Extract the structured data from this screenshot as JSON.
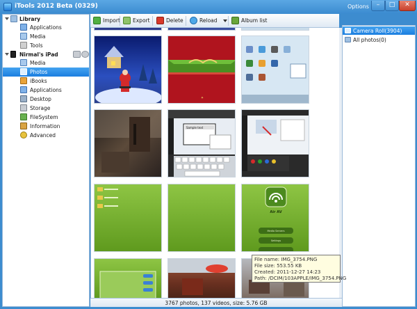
{
  "window": {
    "title": "iTools 2012 Beta (0329)",
    "options_label": "Options",
    "minimize": "–",
    "maximize": "□",
    "close": "✕"
  },
  "sidebar": {
    "library": {
      "label": "Library",
      "items": [
        {
          "label": "Applications",
          "icon": "applications-icon"
        },
        {
          "label": "Media",
          "icon": "media-icon"
        },
        {
          "label": "Tools",
          "icon": "tools-icon"
        }
      ]
    },
    "device": {
      "label": "Nirmal's iPad",
      "items": [
        {
          "label": "Media",
          "icon": "media-icon"
        },
        {
          "label": "Photos",
          "icon": "photos-icon",
          "selected": true
        },
        {
          "label": "iBooks",
          "icon": "ibooks-icon"
        },
        {
          "label": "Applications",
          "icon": "applications-icon"
        },
        {
          "label": "Desktop",
          "icon": "desktop-icon"
        },
        {
          "label": "Storage",
          "icon": "storage-icon"
        },
        {
          "label": "FileSystem",
          "icon": "filesystem-icon"
        },
        {
          "label": "Information",
          "icon": "information-icon"
        },
        {
          "label": "Advanced",
          "icon": "advanced-icon"
        }
      ]
    }
  },
  "toolbar": {
    "import_label": "Import",
    "export_label": "Export",
    "delete_label": "Delete",
    "reload_label": "Reload",
    "album_list_label": "Album list"
  },
  "albums": [
    {
      "label": "Camera Roll(3904)",
      "selected": true
    },
    {
      "label": "All photos(0)",
      "selected": false
    }
  ],
  "photos": [
    {
      "id": "winter-santa"
    },
    {
      "id": "red-christmas-card"
    },
    {
      "id": "ipad-home-screen"
    },
    {
      "id": "dark-room"
    },
    {
      "id": "ipad-sample-text"
    },
    {
      "id": "ipad-browser"
    },
    {
      "id": "green-folders"
    },
    {
      "id": "green-blank"
    },
    {
      "id": "air-av"
    },
    {
      "id": "settings-partial"
    },
    {
      "id": "outdoor-partial"
    },
    {
      "id": "people-partial"
    }
  ],
  "photo_text": {
    "sample_text": "Sample text",
    "air_av_title": "Air AV",
    "air_av_media_servers": "Media Servers",
    "air_av_settings": "Settings"
  },
  "tooltip": {
    "file_name": "File name:  IMG_3754.PNG",
    "file_size": "File size:  553.55 KB",
    "created": "Created:  2011-12-27 14:23",
    "path": "Path:  /DCIM/103APPLE/IMG_3754.PNG"
  },
  "status": {
    "summary": "3767 photos, 137 videos, size: 5.76 GB"
  },
  "colors": {
    "accent": "#1b7ee0",
    "titlebar": "#3b8bd0",
    "close": "#c8402b"
  }
}
